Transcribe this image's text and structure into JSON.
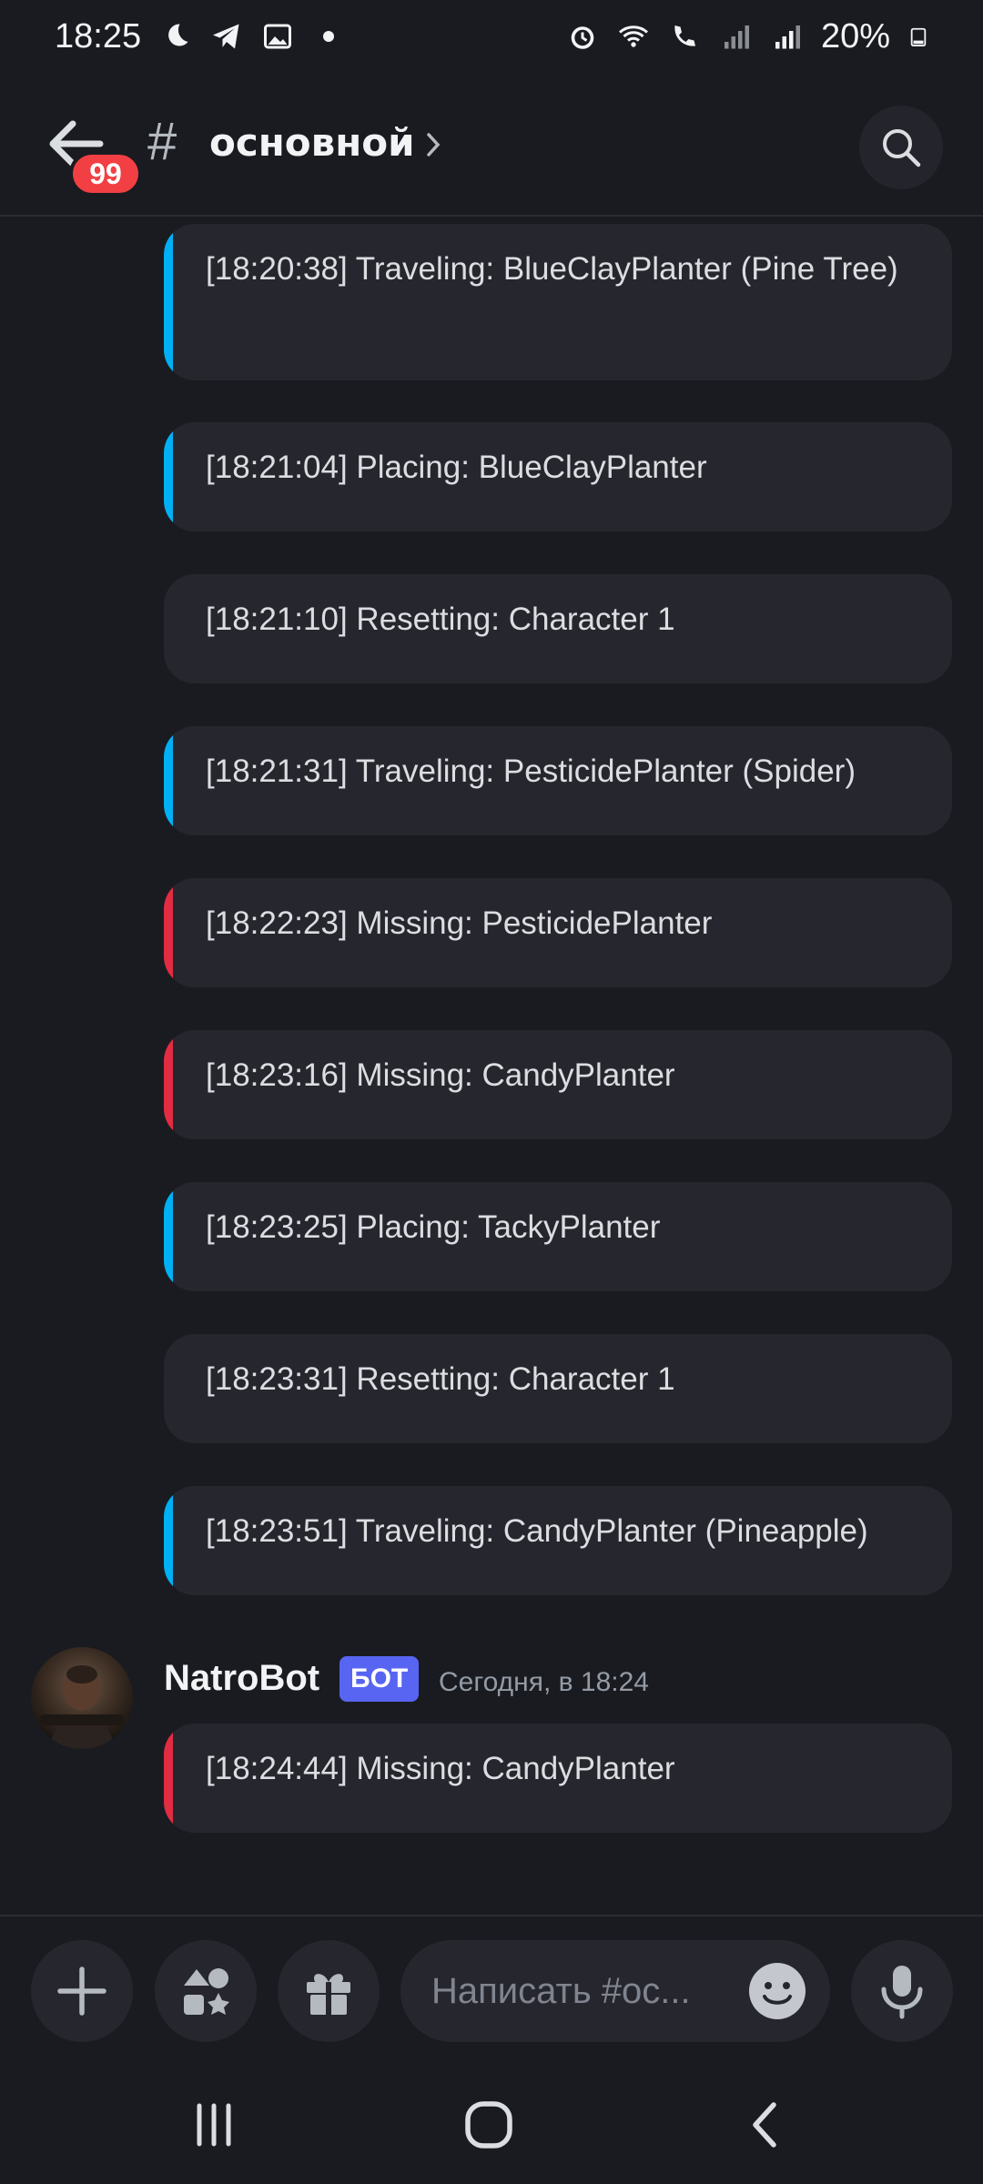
{
  "status_bar": {
    "time": "18:25",
    "battery": "20%",
    "icons": [
      "moon-icon",
      "telegram-icon",
      "gallery-icon",
      "dot-icon",
      "alarm-icon",
      "wifi-icon",
      "wifi-calling-icon",
      "signal-icon",
      "signal-r-icon",
      "battery-icon"
    ]
  },
  "header": {
    "unread_count": "99",
    "channel_name": "основной",
    "colors": {
      "badge": "#f23f43"
    }
  },
  "colors": {
    "bar_blue": "#00b0f4",
    "bar_red": "#e12c43",
    "bot_tag": "#5865f2"
  },
  "messages": [
    {
      "text": "[18:20:38] Traveling: BlueClayPlanter (Pine Tree)",
      "accent": "blue"
    },
    {
      "text": "[18:21:04] Placing: BlueClayPlanter",
      "accent": "blue"
    },
    {
      "text": "[18:21:10] Resetting: Character 1",
      "accent": "none"
    },
    {
      "text": "[18:21:31] Traveling: PesticidePlanter (Spider)",
      "accent": "blue"
    },
    {
      "text": "[18:22:23] Missing: PesticidePlanter",
      "accent": "red"
    },
    {
      "text": "[18:23:16] Missing: CandyPlanter",
      "accent": "red"
    },
    {
      "text": "[18:23:25] Placing: TackyPlanter",
      "accent": "blue"
    },
    {
      "text": "[18:23:31] Resetting: Character 1",
      "accent": "none"
    },
    {
      "text": "[18:23:51] Traveling: CandyPlanter (Pineapple)",
      "accent": "blue"
    }
  ],
  "author_group": {
    "name": "NatroBot",
    "tag": "БОТ",
    "timestamp": "Сегодня, в 18:24",
    "messages": [
      {
        "text": "[18:24:44] Missing: CandyPlanter",
        "accent": "red"
      }
    ]
  },
  "composer": {
    "placeholder": "Написать #ос...",
    "buttons": [
      "plus-icon",
      "apps-icon",
      "gift-icon",
      "emoji-icon",
      "mic-icon"
    ]
  },
  "navbar": {
    "buttons": [
      "recents-icon",
      "home-icon",
      "back-icon"
    ]
  }
}
